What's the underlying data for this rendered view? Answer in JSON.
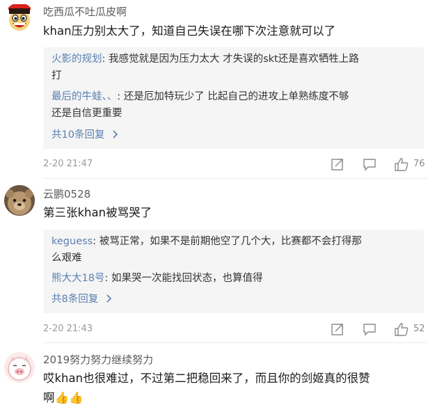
{
  "comments": [
    {
      "user": "吃西瓜不吐瓜皮啊",
      "text": "khan压力别太大了，知道自己失误在哪下次注意就可以了",
      "replies": [
        {
          "name": "火影的规划",
          "sep": ": ",
          "text_line1": "我感觉就是因为压力太大 才失误的skt还是喜欢牺牲上路",
          "text_line2": "打"
        },
        {
          "name": "最后的牛蛙、、",
          "sep": ": ",
          "text_line1": "还是厄加特玩少了 比起自己的进攻上单熟练度不够",
          "text_line2": "还是自信更重要"
        }
      ],
      "more": "共10条回复",
      "time": "2-20 21:47",
      "likes": "76"
    },
    {
      "user": "云鹏0528",
      "text": "第三张khan被骂哭了",
      "replies": [
        {
          "name": "keguess",
          "sep": ": ",
          "text_line1": "被骂正常，如果不是前期他空了几个大，比赛都不会打得那",
          "text_line2": "么艰难"
        },
        {
          "name": "熊大大18号",
          "sep": ": ",
          "text_line1": "如果哭一次能找回状态，也算值得",
          "text_line2": ""
        }
      ],
      "more": "共8条回复",
      "time": "2-20 21:43",
      "likes": "52"
    },
    {
      "user": "2019努力努力继续努力",
      "text_line1": "哎khan也很难过，不过第二把稳回来了，而且你的剑姬真的很赞",
      "text_line2": "啊👍👍"
    }
  ],
  "icons": {
    "share": "share-icon",
    "comment": "comment-icon",
    "like": "thumbs-up-icon",
    "more": "chevron-right-icon"
  }
}
